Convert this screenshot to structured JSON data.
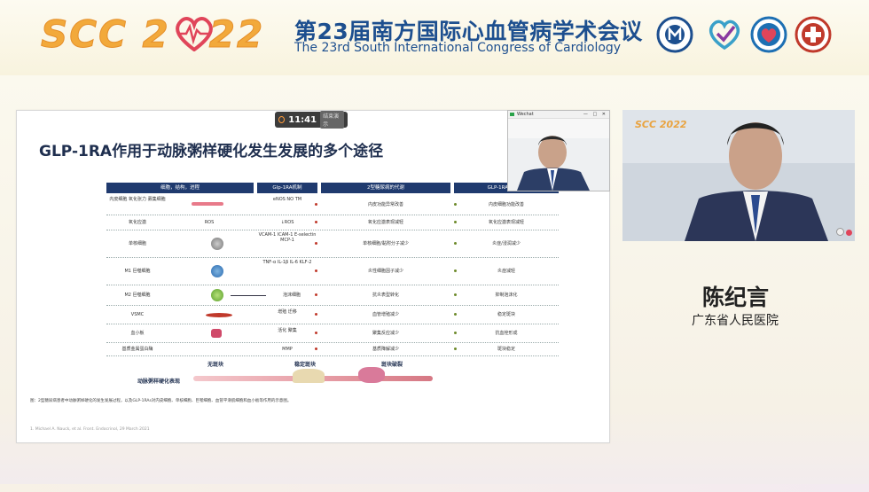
{
  "header": {
    "logo_text": "SCC 2",
    "logo_text_tail": "22",
    "title_cn": "第23届南方国际心血管病学术会议",
    "title_en": "The 23rd South International Congress of Cardiology",
    "org_logos": [
      "hospital-seal-icon",
      "heart-check-icon",
      "heart-shield-icon",
      "cross-seal-icon"
    ]
  },
  "presentation": {
    "timer": "11:41",
    "timer_button": "结束演示",
    "slide_title": "GLP-1RA作用于动脉粥样硬化发生发展的多个途径",
    "table_headers": [
      "细胞，结构，进程",
      "Glp-1RA机制",
      "2型糖尿病的代谢",
      "GLP-1RAs的作用"
    ],
    "rows": [
      {
        "cell": "内皮细胞 氧化张力 募集细胞",
        "mech": "eNOS NO TM",
        "metab": "内皮功能异常改善",
        "effect": "内皮细胞功能改善"
      },
      {
        "cell": "氧化应激",
        "icon": "ROS",
        "mech": "↓ROS",
        "metab": "氧化应激表现减轻",
        "effect": "氧化应激表现减轻"
      },
      {
        "cell": "单核细胞",
        "mech": "VCAM-1 ICAM-1 E-selectin MCP-1",
        "metab": "单核细胞/黏附分子减少",
        "effect": "炎症/浸润减少"
      },
      {
        "cell": "M1 巨噬细胞",
        "mech": "TNF-α IL-1β IL-6 KLF-2",
        "metab": "炎性细胞因子减少",
        "effect": "炎症减轻"
      },
      {
        "cell": "M2 巨噬细胞",
        "mech": "泡沫细胞",
        "metab": "抗炎表型转化",
        "effect": "抑制泡沫化"
      },
      {
        "cell": "VSMC",
        "mech": "增殖 迁移",
        "metab": "血管增殖减少",
        "effect": "稳定斑块"
      },
      {
        "cell": "血小板",
        "mech": "活化 聚集",
        "metab": "聚集反应减少",
        "effect": "抗血栓形成"
      },
      {
        "cell": "基质金属蛋白酶",
        "mech": "MMP",
        "metab": "基质降解减少",
        "effect": "斑块稳定"
      }
    ],
    "progression_label": "动脉粥样硬化表现",
    "stage_labels": [
      "无斑块",
      "稳定斑块",
      "斑块破裂"
    ],
    "caption": "图：2型糖尿病患者中动脉粥样硬化的发生发展过程，以及GLP-1RAs对内皮细胞、单核细胞、巨噬细胞、血管平滑肌细胞和血小板等作用的示意图。",
    "reference": "1. Michael A. Nauck, et al. Front. Endocrinol, 29 March 2021"
  },
  "video_window": {
    "title": "Wechat",
    "buttons": "— □ ✕"
  },
  "speaker": {
    "panel_logo": "SCC 2022",
    "name": "陈纪言",
    "org": "广东省人民医院"
  },
  "colors": {
    "brand_orange": "#f2a93b",
    "brand_blue": "#1d4f8f",
    "table_header": "#1f3a6e"
  }
}
